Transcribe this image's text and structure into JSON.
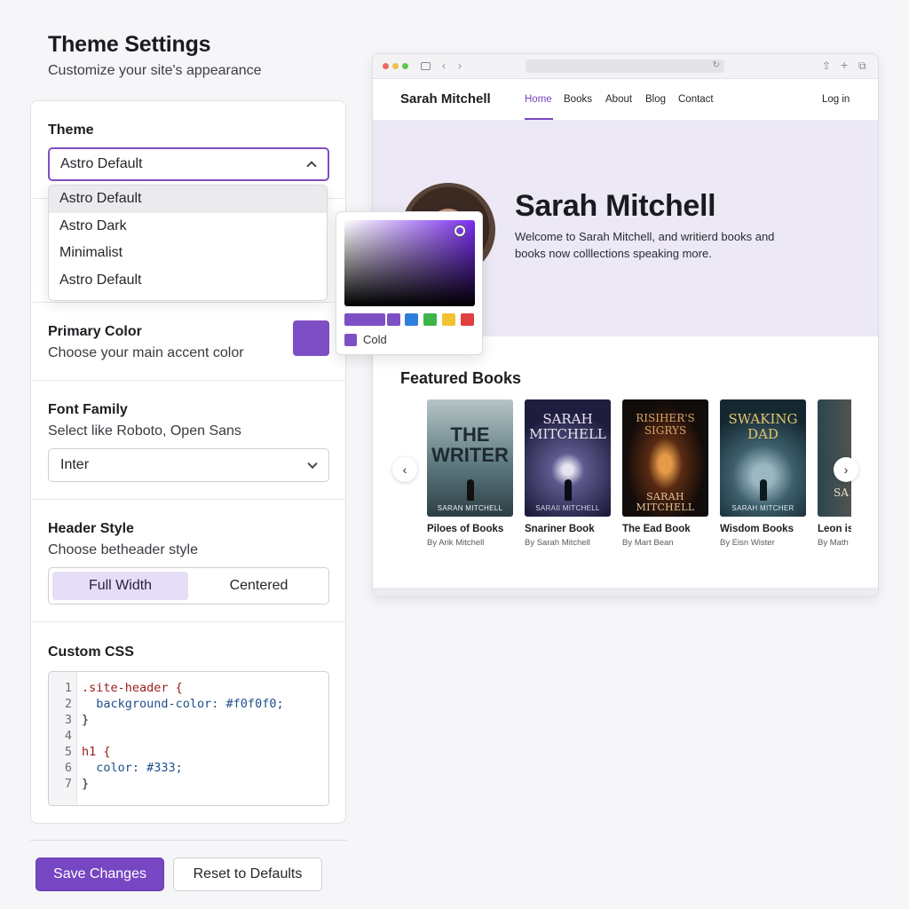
{
  "header": {
    "title": "Theme Settings",
    "subtitle": "Customize your site's appearance"
  },
  "theme": {
    "label": "Theme",
    "selected": "Astro Default",
    "options": [
      "Astro Default",
      "Astro Dark",
      "Minimalist",
      "Astro Default"
    ]
  },
  "primary_color": {
    "label": "Primary Color",
    "description": "Choose your main accent color",
    "value_color": "#7e4fc4",
    "picker": {
      "preset_colors": [
        "#7e4fc4",
        "#7e4fc4",
        "#2d7fdc",
        "#3bb54a",
        "#f2c230",
        "#e04040"
      ],
      "selected_name": "Cold"
    }
  },
  "font_family": {
    "label": "Font Family",
    "description": "Select like Roboto, Open Sans",
    "selected": "Inter"
  },
  "header_style": {
    "label": "Header Style",
    "description": "Choose betheader style",
    "options": [
      "Full Width",
      "Centered"
    ],
    "active": "Full Width"
  },
  "custom_css": {
    "label": "Custom CSS",
    "line_numbers": [
      "1",
      "2",
      "3",
      "4",
      "5",
      "6",
      "7"
    ],
    "lines": [
      ".site-header {",
      "  background-color: #f0f0f0;",
      "}",
      "",
      "h1 {",
      "  color: #333;",
      "}"
    ]
  },
  "actions": {
    "save": "Save Changes",
    "reset": "Reset to Defaults"
  },
  "preview": {
    "site_name": "Sarah Mitchell",
    "nav": [
      "Home",
      "Books",
      "About",
      "Blog",
      "Contact"
    ],
    "active_nav": "Home",
    "login": "Log in",
    "hero": {
      "name": "Sarah Mitchell",
      "text": "Welcome to Sarah Mitchell, and writierd books and books now colllections speaking more."
    },
    "featured_title": "Featured Books",
    "books": [
      {
        "cover_title": "THE WRITER",
        "cover_author": "SARAN MITCHELL",
        "title": "Piloes of Books",
        "author": "By Arik Mitchell"
      },
      {
        "cover_title": "SARAH MITCHELL",
        "cover_author": "SARAII MITCHELL",
        "title": "Snariner Book",
        "author": "By Sarah Mitchell"
      },
      {
        "cover_title": "RISIHER'S SIGRYS",
        "cover_author": "SARAH MITCHELL",
        "title": "The Ead Book",
        "author": "By Mart Bean"
      },
      {
        "cover_title": "SWAKING DAD",
        "cover_author": "SARAH MITCHER",
        "title": "Wisdom Books",
        "author": "By Eisn Wister"
      },
      {
        "cover_title": "SA MIT",
        "cover_author": "",
        "title": "Leon is",
        "author": "By Math"
      }
    ]
  },
  "colors": {
    "accent": "#7746c2",
    "hero_bg": "#ece8f5"
  }
}
